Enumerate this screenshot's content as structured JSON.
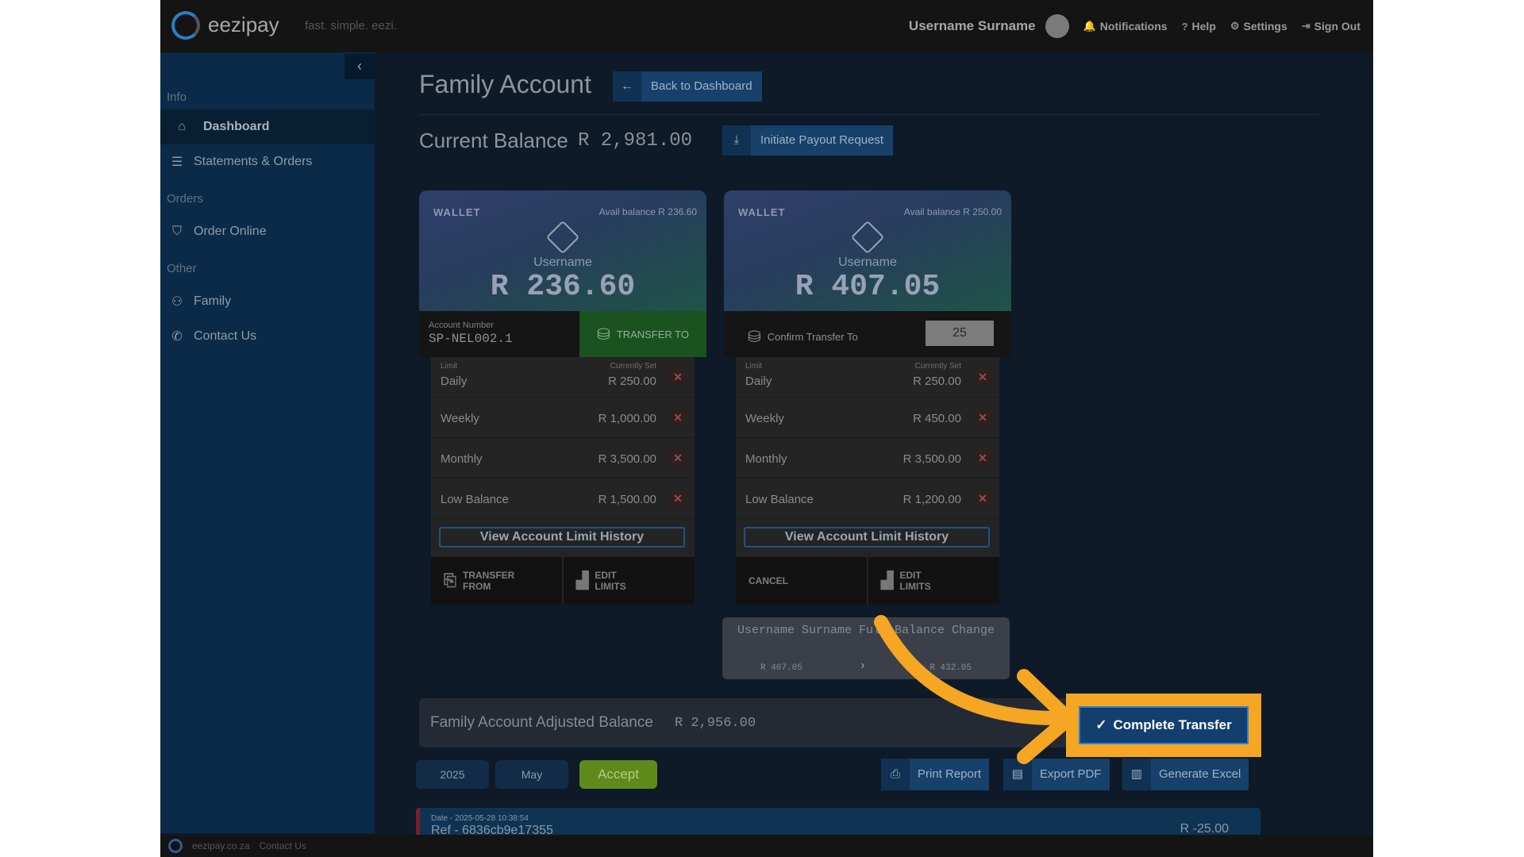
{
  "topbar": {
    "logo_text": "eezipay",
    "tagline": "fast. simple. eezi.",
    "user_name": "Username Surname",
    "notifications": "Notifications",
    "help": "Help",
    "settings": "Settings",
    "sign_out": "Sign Out"
  },
  "sidebar": {
    "collapse_glyph": "‹",
    "sections": [
      "Info",
      "Orders",
      "Other"
    ],
    "items": [
      {
        "label": "Dashboard",
        "icon": "home-icon",
        "active": true
      },
      {
        "label": "Statements & Orders",
        "icon": "list-icon"
      },
      {
        "label": "Order Online",
        "icon": "basket-icon"
      },
      {
        "label": "Family",
        "icon": "family-icon"
      },
      {
        "label": "Contact Us",
        "icon": "phone-icon"
      }
    ]
  },
  "main": {
    "title": "Family Account",
    "back_button": "Back to Dashboard",
    "balance_label": "Current Balance",
    "balance_value": "R 2,981.00",
    "payout_button": "Initiate Payout Request"
  },
  "wallets": [
    {
      "label": "WALLET",
      "avail": "Avail balance R 236.60",
      "user": "Username",
      "amount": "R 236.60",
      "account_label": "Account Number",
      "account_number": "SP-NEL002.1",
      "transfer_button": "TRANSFER TO",
      "limits": [
        {
          "small_left": "Limit",
          "small_right": "Currently Set",
          "name": "Daily",
          "value": "R 250.00"
        },
        {
          "name": "Weekly",
          "value": "R 1,000.00"
        },
        {
          "name": "Monthly",
          "value": "R 3,500.00"
        },
        {
          "name": "Low Balance",
          "value": "R 1,500.00"
        }
      ],
      "history_button": "View Account Limit History",
      "action_left": "TRANSFER FROM",
      "action_right": "EDIT LIMITS"
    },
    {
      "label": "WALLET",
      "avail": "Avail balance R 250.00",
      "user": "Username",
      "amount": "R 407.05",
      "confirm_label": "Confirm Transfer To",
      "confirm_value": "25",
      "limits": [
        {
          "small_left": "Limit",
          "small_right": "Currently Set",
          "name": "Daily",
          "value": "R 250.00"
        },
        {
          "name": "Weekly",
          "value": "R 450.00"
        },
        {
          "name": "Monthly",
          "value": "R 3,500.00"
        },
        {
          "name": "Low Balance",
          "value": "R 1,200.00"
        }
      ],
      "history_button": "View Account Limit History",
      "action_left": "CANCEL",
      "action_right": "EDIT LIMITS"
    }
  ],
  "balance_change": {
    "title": "Username Surname Full Balance Change",
    "from": "R 407.05",
    "to": "R 432.05"
  },
  "adjusted": {
    "label": "Family Account Adjusted Balance",
    "value": "R 2,956.00"
  },
  "complete_button": "Complete Transfer",
  "filters": {
    "year": "2025",
    "month": "May",
    "accept": "Accept"
  },
  "tools": {
    "print": "Print Report",
    "pdf": "Export PDF",
    "excel": "Generate Excel"
  },
  "transaction": {
    "date": "Date - 2025-05-28 10:38:54",
    "ref": "Ref - 6836cb9e17355",
    "amount": "R -25.00"
  },
  "footer": {
    "site": "eezipay.co.za",
    "contact": "Contact Us"
  },
  "colors": {
    "highlight": "#f5a623",
    "accent": "#17406a",
    "transfer_green": "#1a531f"
  }
}
